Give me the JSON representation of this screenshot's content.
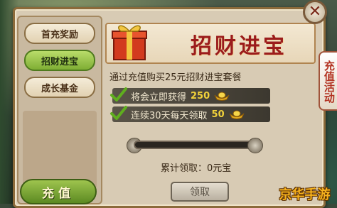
{
  "sidebar": {
    "items": [
      {
        "label": "首充奖励",
        "active": false
      },
      {
        "label": "招财进宝",
        "active": true
      },
      {
        "label": "成长基金",
        "active": false
      }
    ],
    "recharge_label": "充值"
  },
  "banner": {
    "title": "招财进宝"
  },
  "content": {
    "description": "通过充值购买25元招财进宝套餐",
    "rewards": [
      {
        "text": "将会立即获得",
        "value": "250",
        "icon": "gold-ingot-icon"
      },
      {
        "text": "连续30天每天领取",
        "value": "50",
        "icon": "gold-ingot-icon"
      }
    ],
    "progress": 0,
    "accumulated": "累计领取：0元宝",
    "claim_label": "领取"
  },
  "side_tab": {
    "label": "充值活动"
  },
  "close_label": "✕",
  "watermark": "京华手游",
  "colors": {
    "panel": "#d8cbb4",
    "active_tab": "#7fae34",
    "title_red": "#9b1c1c",
    "value_gold": "#f2d23a"
  }
}
